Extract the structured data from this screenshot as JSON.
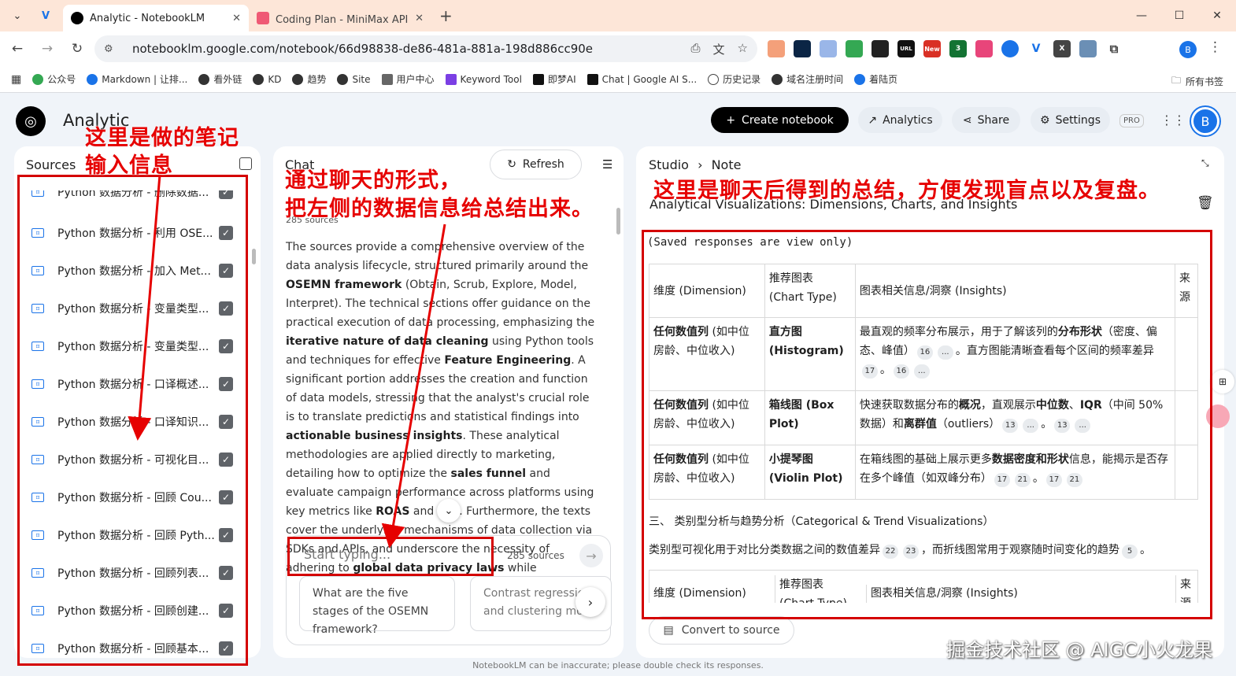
{
  "browser": {
    "tabs": [
      {
        "title": "Analytic - NotebookLM",
        "active": true
      },
      {
        "title": "Coding Plan - MiniMax API开",
        "active": false
      }
    ],
    "url": "notebooklm.google.com/notebook/66d98838-de86-481a-881a-198d886cc90e",
    "profile_initial": "B",
    "ext_new_badge": "New",
    "ext_count_badge": "3",
    "bookmarks": [
      "公众号",
      "Markdown | 让排...",
      "看外链",
      "KD",
      "趋势",
      "Site",
      "用户中心",
      "Keyword Tool",
      "即梦AI",
      "Chat | Google AI S...",
      "历史记录",
      "域名注册时间",
      "着陆页"
    ],
    "bookmarks_all": "所有书签"
  },
  "header": {
    "title": "Analytic",
    "create_label": "Create notebook",
    "analytics_label": "Analytics",
    "share_label": "Share",
    "settings_label": "Settings",
    "pro_label": "PRO",
    "avatar_initial": "B"
  },
  "sources": {
    "title": "Sources",
    "items": [
      "Python 数据分析 - 删除数据...",
      "Python 数据分析 - 利用 OSE...",
      "Python 数据分析 - 加入 Met...",
      "Python 数据分析 - 变量类型...",
      "Python 数据分析 - 变量类型...",
      "Python 数据分析 - 口译概述...",
      "Python 数据分析 - 口译知识...",
      "Python 数据分析 - 可视化目...",
      "Python 数据分析 - 回顾 Cou...",
      "Python 数据分析 - 回顾 Pyth...",
      "Python 数据分析 - 回顾列表...",
      "Python 数据分析 - 回顾创建...",
      "Python 数据分析 - 回顾基本..."
    ]
  },
  "chat": {
    "title": "Chat",
    "refresh_label": "Refresh",
    "source_count": "285 sources",
    "input_placeholder": "Start typing...",
    "input_source_count": "285 sources",
    "suggestions": [
      "What are the five stages of the OSEMN framework?",
      "Contrast regression and clustering mo"
    ]
  },
  "studio": {
    "breadcrumb_root": "Studio",
    "breadcrumb_leaf": "Note",
    "note_title": "Analytical Visualizations: Dimensions, Charts, and Insights",
    "view_only": "(Saved responses are view only)",
    "table_headers": [
      "维度 (Dimension)",
      "推荐图表 (Chart Type)",
      "图表相关信息/洞察 (Insights)",
      "来源"
    ],
    "rows": [
      {
        "dim_bold": "任何数值列",
        "dim_rest": " (如中位房龄、中位收入)",
        "chart": "直方图 (Histogram)",
        "ins_a": "最直观的频率分布展示，用于了解该列的",
        "ins_bold": "分布形状",
        "ins_b": "（密度、偏态、峰值）",
        "ins_c": "。直方图能清晰查看每个区间的频率差异",
        "cites": [
          "16",
          "...",
          "17",
          "16",
          "..."
        ]
      },
      {
        "dim_bold": "任何数值列",
        "dim_rest": " (如中位房龄、中位收入)",
        "chart": "箱线图 (Box Plot)",
        "ins_a": "快速获取数据分布的",
        "ins_bold": "概况",
        "ins_b": "，直观展示",
        "ins_bold2": "中位数",
        "ins_b2": "、",
        "ins_bold3": "IQR",
        "ins_c": "（中间 50% 数据）和",
        "ins_bold4": "离群值",
        "ins_d": "（outliers）",
        "cites": [
          "13",
          "...",
          "13",
          "..."
        ]
      },
      {
        "dim_bold": "任何数值列",
        "dim_rest": " (如中位房龄、中位收入)",
        "chart": "小提琴图 (Violin Plot)",
        "ins_a": "在箱线图的基础上展示更多",
        "ins_bold": "数据密度和形状",
        "ins_b": "信息，能揭示是否存在多个峰值（如双峰分布）",
        "cites": [
          "17",
          "21",
          "17",
          "21"
        ]
      }
    ],
    "section_heading": "三、 类别型分析与趋势分析（Categorical & Trend Visualizations）",
    "section_text_a": "类别型可视化用于对比分类数据之间的数值差异",
    "section_text_b": "，而折线图常用于观察随时间变化的趋势",
    "section_cites": [
      "22",
      "23",
      "5"
    ],
    "table2_headers": [
      "维度 (Dimension)",
      "推荐图表 (Chart Type)",
      "图表相关信息/洞察 (Insights)",
      "来源"
    ],
    "convert_label": "Convert to source"
  },
  "annotations": {
    "left": "这里是做的笔记\n输入信息",
    "middle": "通过聊天的形式，\n把左侧的数据信息给总结出来。",
    "right": "这里是聊天后得到的总结，方便发现盲点以及复盘。"
  },
  "footer": "NotebookLM can be inaccurate; please double check its responses.",
  "watermark": "掘金技术社区 @ AIGC小火龙果"
}
